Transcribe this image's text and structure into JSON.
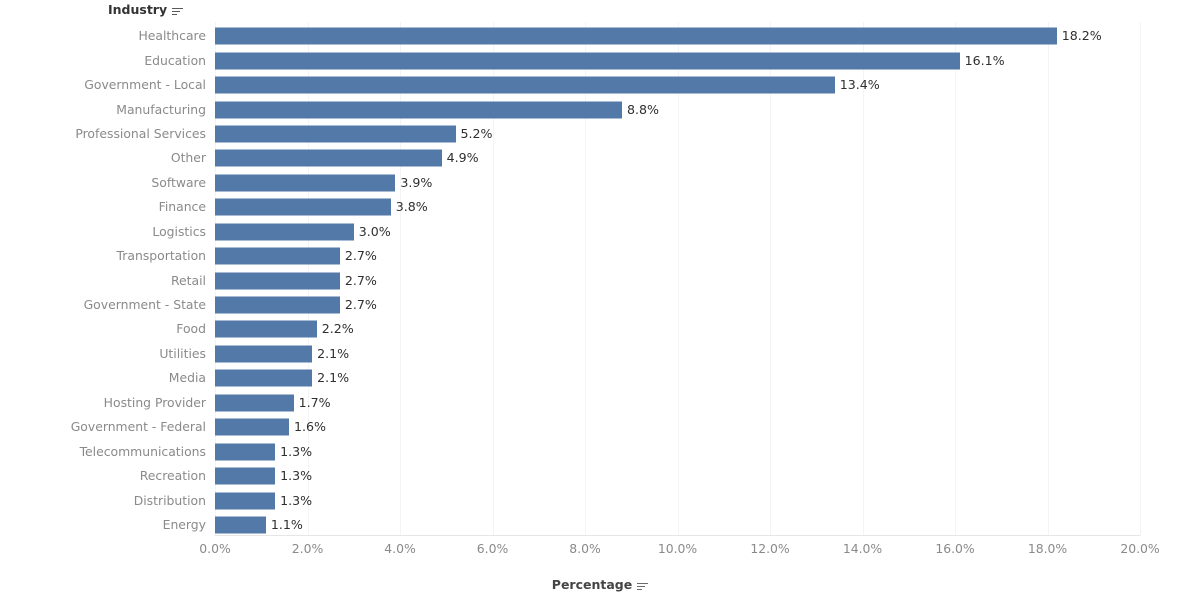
{
  "chart_data": {
    "type": "bar",
    "orientation": "horizontal",
    "title": "",
    "subtitle": "",
    "xlabel": "Percentage",
    "ylabel": "Industry",
    "xlim": [
      0,
      20
    ],
    "xticks": [
      "0.0%",
      "2.0%",
      "4.0%",
      "6.0%",
      "8.0%",
      "10.0%",
      "12.0%",
      "14.0%",
      "16.0%",
      "18.0%",
      "20.0%"
    ],
    "xtick_values": [
      0,
      2,
      4,
      6,
      8,
      10,
      12,
      14,
      16,
      18,
      20
    ],
    "grid": true,
    "legend": "none",
    "bar_color": "#5279a7",
    "value_label_suffix": "%",
    "categories": [
      "Healthcare",
      "Education",
      "Government - Local",
      "Manufacturing",
      "Professional Services",
      "Other",
      "Software",
      "Finance",
      "Logistics",
      "Transportation",
      "Retail",
      "Government - State",
      "Food",
      "Utilities",
      "Media",
      "Hosting Provider",
      "Government - Federal",
      "Telecommunications",
      "Recreation",
      "Distribution",
      "Energy"
    ],
    "values": [
      18.2,
      16.1,
      13.4,
      8.8,
      5.2,
      4.9,
      3.9,
      3.8,
      3.0,
      2.7,
      2.7,
      2.7,
      2.2,
      2.1,
      2.1,
      1.7,
      1.6,
      1.3,
      1.3,
      1.3,
      1.1
    ],
    "value_labels": [
      "18.2%",
      "16.1%",
      "13.4%",
      "8.8%",
      "5.2%",
      "4.9%",
      "3.9%",
      "3.8%",
      "3.0%",
      "2.7%",
      "2.7%",
      "2.7%",
      "2.2%",
      "2.1%",
      "2.1%",
      "1.7%",
      "1.6%",
      "1.3%",
      "1.3%",
      "1.3%",
      "1.1%"
    ]
  },
  "header": {
    "industry_label": "Industry",
    "industry_sort_icon": "sort-descending-icon"
  },
  "axis": {
    "x_title": "Percentage",
    "x_title_sort_icon": "sort-descending-icon"
  },
  "colors": {
    "bar": "#5279a7",
    "category_text": "#8a8a8a",
    "value_text": "#2f2f2f",
    "header_text": "#333333",
    "gridline": "#f4f4f4",
    "background": "#ffffff"
  }
}
